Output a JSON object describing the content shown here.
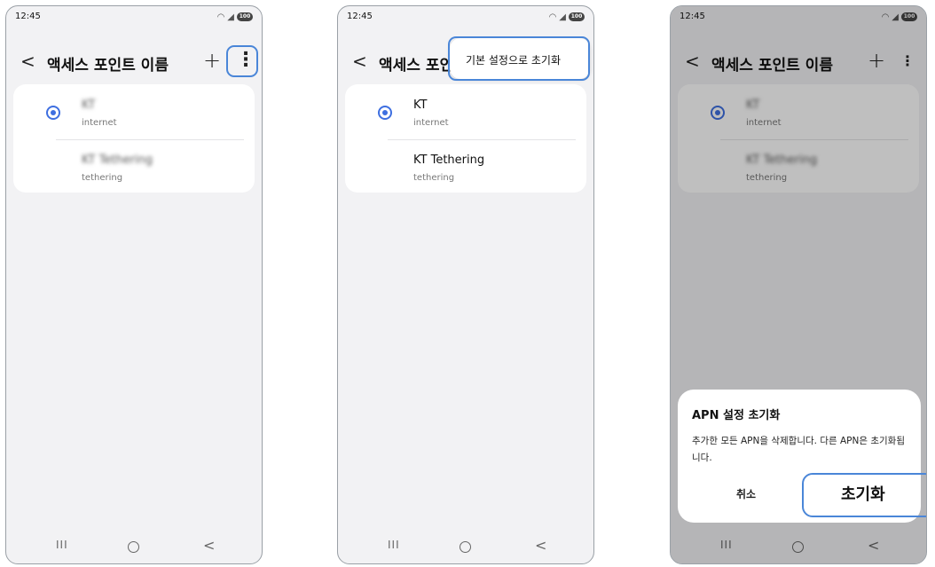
{
  "status_time": "12:45",
  "battery": "100",
  "screen": {
    "title": "액세스 포인트 이름",
    "back_glyph": "<",
    "add_glyph": "+",
    "more_glyph": "⋮",
    "apns": [
      {
        "name": "KT",
        "type": "internet",
        "selected": true
      },
      {
        "name": "KT Tethering",
        "type": "tethering",
        "selected": false
      }
    ]
  },
  "menu": {
    "reset_default": "기본 설정으로 초기화"
  },
  "dialog": {
    "title": "APN 설정 초기화",
    "message": "추가한 모든 APN을 삭제합니다. 다른 APN은 초기화됩니다.",
    "cancel_label": "취소",
    "confirm_label": "초기화"
  },
  "nav": {
    "recent_glyph": "III",
    "back_glyph": "<"
  },
  "colors": {
    "accent": "#3e6fe0",
    "highlight": "#4a86d8"
  }
}
